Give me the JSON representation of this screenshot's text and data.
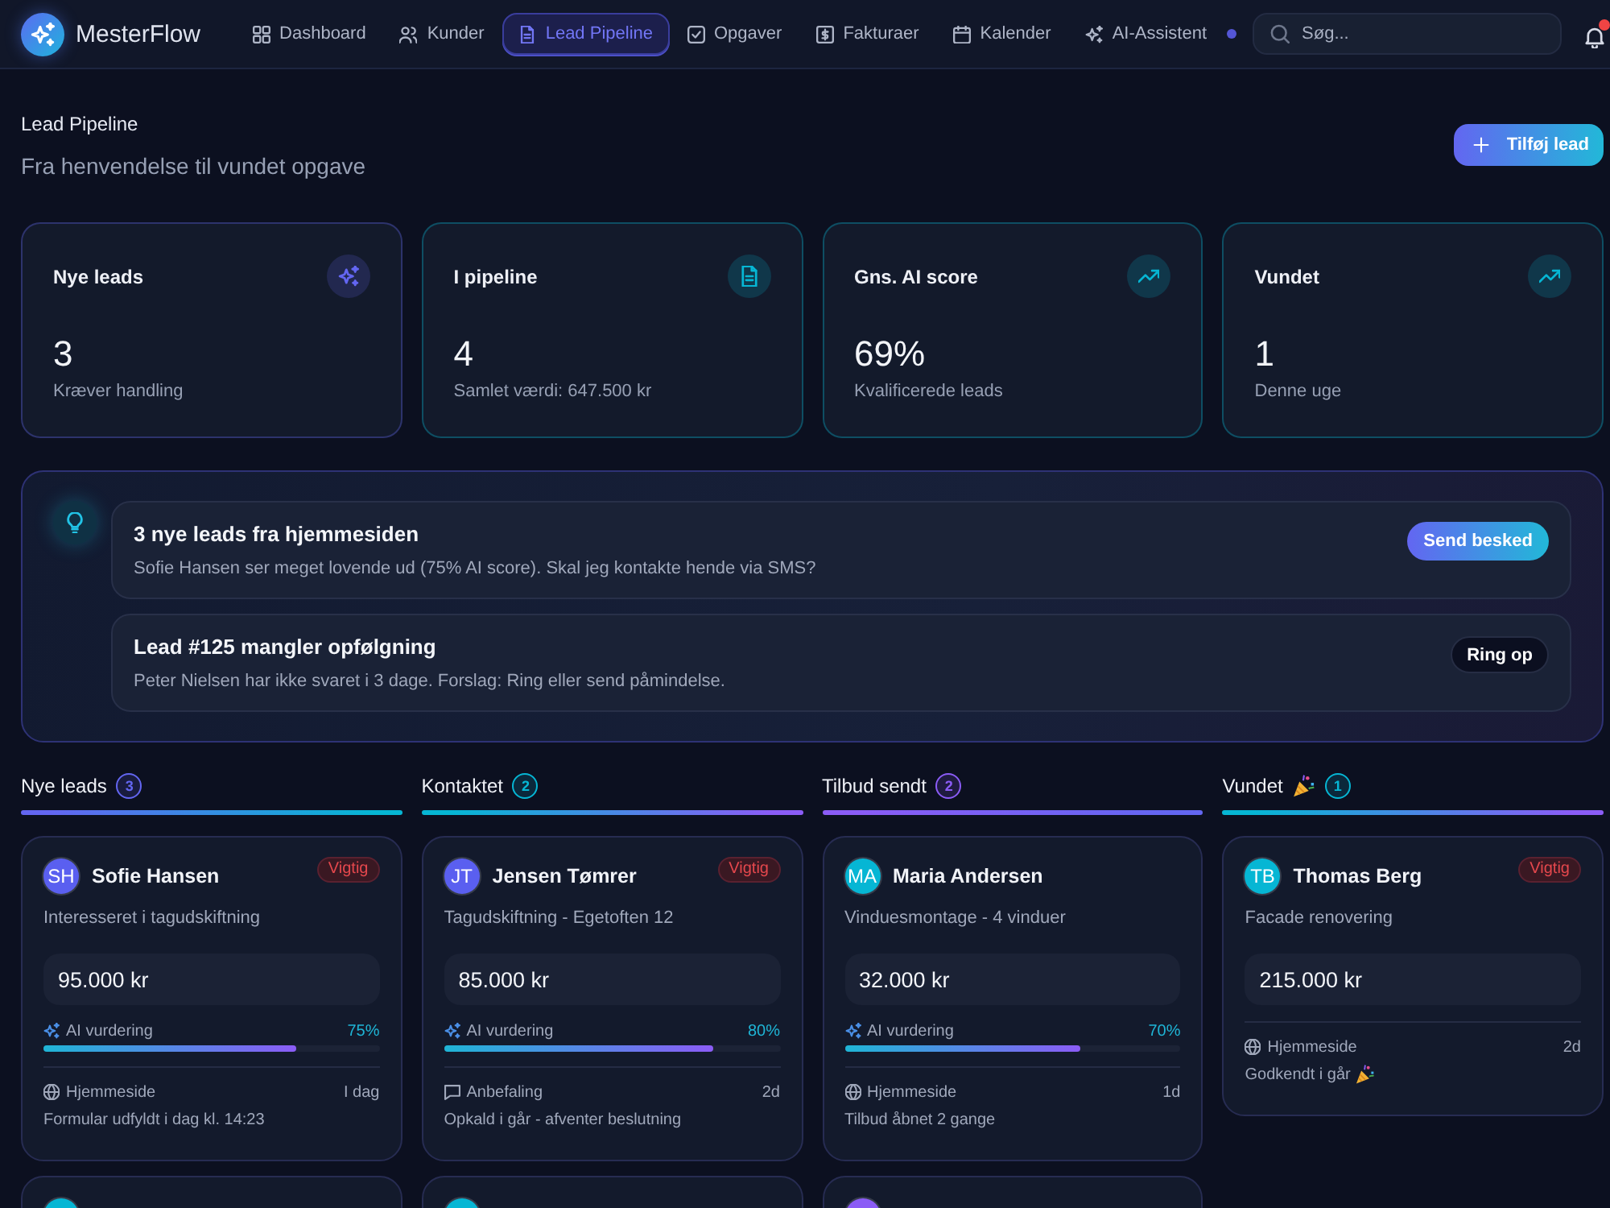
{
  "nav": {
    "brand": "MesterFlow",
    "items": [
      {
        "label": "Dashboard",
        "selected": false,
        "dot": false
      },
      {
        "label": "Kunder",
        "selected": false,
        "dot": false
      },
      {
        "label": "Lead Pipeline",
        "selected": true,
        "dot": false
      },
      {
        "label": "Opgaver",
        "selected": false,
        "dot": false
      },
      {
        "label": "Fakturaer",
        "selected": false,
        "dot": false
      },
      {
        "label": "Kalender",
        "selected": false,
        "dot": false
      },
      {
        "label": "AI-Assistent",
        "selected": false,
        "dot": true
      }
    ],
    "search": {
      "placeholder": "Søg..."
    },
    "notifications": {
      "unread": true
    }
  },
  "header": {
    "title": "Lead Pipeline",
    "subtitle": "Fra henvendelse til vundet opgave",
    "action": "Tilføj lead"
  },
  "stats": [
    {
      "title": "Nye leads",
      "value": "3",
      "caption": "Kræver handling",
      "color": "#6366f1"
    },
    {
      "title": "I pipeline",
      "value": "4",
      "caption": "Samlet værdi: 647.500 kr",
      "color": "#06b6d4"
    },
    {
      "title": "Gns. AI score",
      "value": "69%",
      "caption": "Kvalificerede leads",
      "color": "#06b6d4"
    },
    {
      "title": "Vundet",
      "value": "1",
      "caption": "Denne uge",
      "color": "#06b6d4"
    }
  ],
  "suggestions": [
    {
      "title": "3 nye leads fra hjemmesiden",
      "body": "Sofie Hansen ser meget lovende ud (75% AI score). Skal jeg kontakte hende via SMS?",
      "action": {
        "label": "Send besked",
        "kind": "primary"
      }
    },
    {
      "title": "Lead #125 mangler opfølgning",
      "body": "Peter Nielsen har ikke svaret i 3 dage. Forslag: Ring eller send påmindelse.",
      "action": {
        "label": "Ring op",
        "kind": "secondary"
      }
    }
  ],
  "columns": [
    {
      "title": "Nye leads",
      "celebrate": false,
      "count": "3",
      "color": "#6366f1",
      "bar": [
        {
          "color": "#6366f1"
        },
        {
          "color": "#06b6d4"
        }
      ],
      "leads": [
        {
          "avatar": {
            "initials": "SH",
            "color": "#5a5ff0"
          },
          "name": "Sofie Hansen",
          "tag": "Vigtig",
          "description": "Interesseret i tagudskiftning",
          "amount": "95.000 kr",
          "ai": {
            "label": "AI vurdering",
            "score": "75%",
            "level": 0.75
          },
          "source": {
            "kind": "web",
            "label": "Hjemmeside",
            "time": "I dag"
          },
          "note": "Formular udfyldt i dag kl. 14:23",
          "celebrate": false
        },
        {
          "avatar": {
            "color": "#06b6d4"
          }
        }
      ]
    },
    {
      "title": "Kontaktet",
      "celebrate": false,
      "count": "2",
      "color": "#06b6d4",
      "bar": [
        {
          "color": "#06b6d4"
        },
        {
          "color": "#8b5cf6"
        }
      ],
      "leads": [
        {
          "avatar": {
            "initials": "JT",
            "color": "#5a5ff0"
          },
          "name": "Jensen Tømrer",
          "tag": "Vigtig",
          "description": "Tagudskiftning - Egetoften 12",
          "amount": "85.000 kr",
          "ai": {
            "label": "AI vurdering",
            "score": "80%",
            "level": 0.8
          },
          "source": {
            "kind": "referral",
            "label": "Anbefaling",
            "time": "2d"
          },
          "note": "Opkald i går - afventer beslutning",
          "celebrate": false
        },
        {
          "avatar": {
            "color": "#06b6d4"
          }
        }
      ]
    },
    {
      "title": "Tilbud sendt",
      "celebrate": false,
      "count": "2",
      "color": "#8b5cf6",
      "bar": [
        {
          "color": "#8b5cf6"
        },
        {
          "color": "#6366f1"
        }
      ],
      "leads": [
        {
          "avatar": {
            "initials": "MA",
            "color": "#06b6d4"
          },
          "name": "Maria Andersen",
          "description": "Vinduesmontage - 4 vinduer",
          "amount": "32.000 kr",
          "ai": {
            "label": "AI vurdering",
            "score": "70%",
            "level": 0.7
          },
          "source": {
            "kind": "web",
            "label": "Hjemmeside",
            "time": "1d"
          },
          "note": "Tilbud åbnet 2 gange",
          "celebrate": false
        },
        {
          "avatar": {
            "color": "#8b5cf6"
          }
        }
      ]
    },
    {
      "title": "Vundet",
      "celebrate": true,
      "count": "1",
      "color": "#06b6d4",
      "bar": [
        {
          "color": "#06b6d4"
        },
        {
          "color": "#8b5cf6"
        }
      ],
      "leads": [
        {
          "avatar": {
            "initials": "TB",
            "color": "#06b6d4"
          },
          "name": "Thomas Berg",
          "tag": "Vigtig",
          "description": "Facade renovering",
          "amount": "215.000 kr",
          "source": {
            "kind": "web",
            "label": "Hjemmeside",
            "time": "2d"
          },
          "note": "Godkendt i går",
          "celebrate": true
        }
      ]
    }
  ]
}
